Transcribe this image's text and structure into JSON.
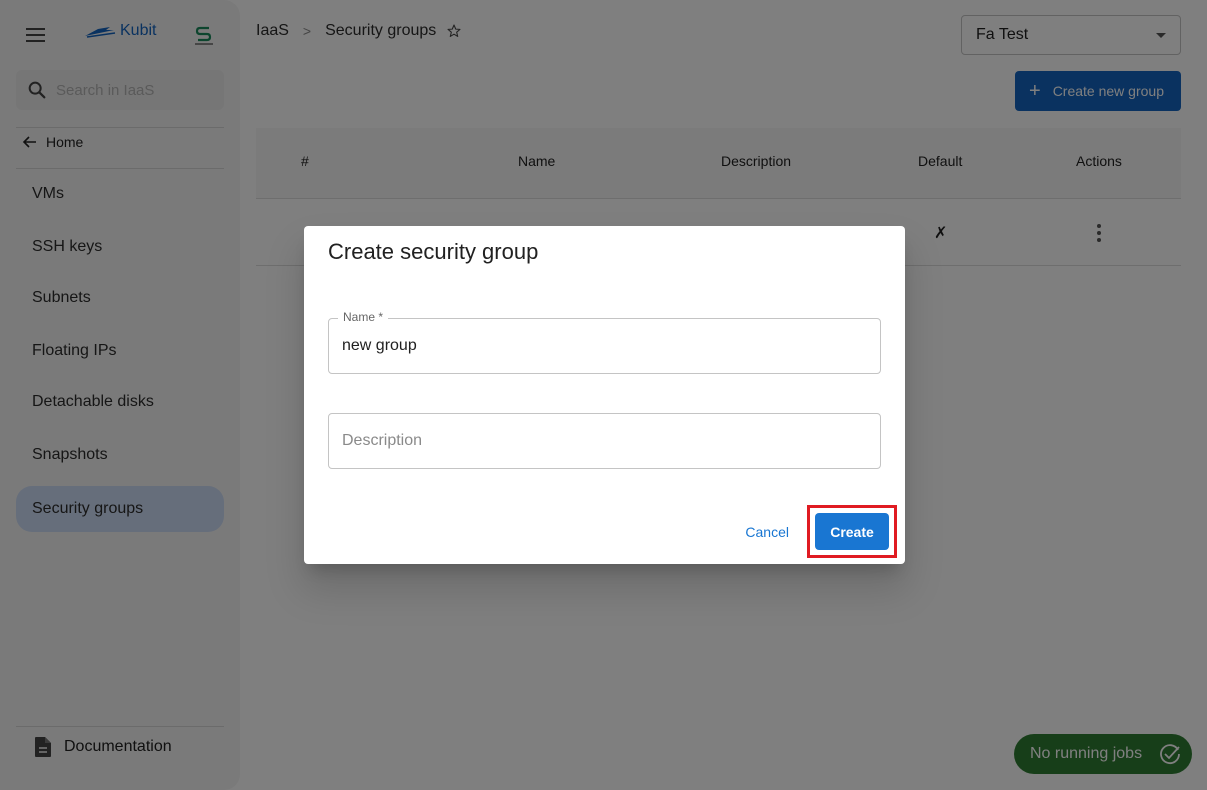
{
  "sidebar": {
    "logo_text": "Kubit",
    "search_placeholder": "Search in IaaS",
    "home_label": "Home",
    "items": [
      {
        "label": "VMs",
        "active": false
      },
      {
        "label": "SSH keys",
        "active": false
      },
      {
        "label": "Subnets",
        "active": false
      },
      {
        "label": "Floating IPs",
        "active": false
      },
      {
        "label": "Detachable disks",
        "active": false
      },
      {
        "label": "Snapshots",
        "active": false
      },
      {
        "label": "Security groups",
        "active": true
      }
    ],
    "documentation_label": "Documentation"
  },
  "header": {
    "breadcrumb": [
      "IaaS",
      "Security groups"
    ],
    "breadcrumb_separator": ">",
    "project_select_value": "Fa Test",
    "create_button_label": "Create new group"
  },
  "table": {
    "columns": [
      "#",
      "Name",
      "Description",
      "Default",
      "Actions"
    ],
    "rows": [
      {
        "default": "✗"
      }
    ]
  },
  "jobs_badge": {
    "label": "No running jobs",
    "color": "#2e7d32"
  },
  "dialog": {
    "title": "Create security group",
    "name_label": "Name *",
    "name_value": "new group",
    "description_placeholder": "Description",
    "description_value": "",
    "cancel_label": "Cancel",
    "create_label": "Create",
    "highlight_color": "#e01b22",
    "primary_color": "#1976d2"
  }
}
